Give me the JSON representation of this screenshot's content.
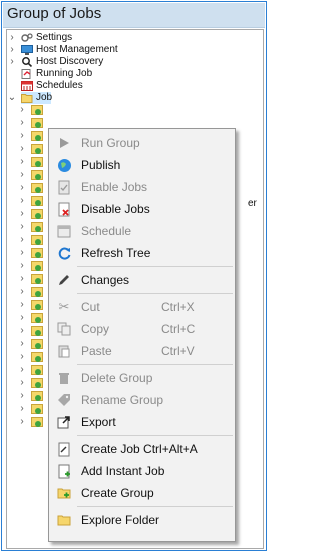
{
  "window": {
    "title": "Group of Jobs"
  },
  "tree": {
    "items": [
      {
        "label": "Settings",
        "icon": "gears-icon"
      },
      {
        "label": "Host Management",
        "icon": "monitor-icon"
      },
      {
        "label": "Host Discovery",
        "icon": "search-icon"
      },
      {
        "label": "Running Job",
        "icon": "running-job-icon"
      },
      {
        "label": "Schedules",
        "icon": "calendar-icon"
      },
      {
        "label": "Job",
        "icon": "folder-open-icon"
      }
    ],
    "side_fragment": "er"
  },
  "menu": {
    "items": [
      {
        "label": "Run Group",
        "icon": "play-icon",
        "enabled": false
      },
      {
        "label": "Publish",
        "icon": "globe-icon",
        "enabled": true
      },
      {
        "label": "Enable Jobs",
        "icon": "enable-doc-icon",
        "enabled": false
      },
      {
        "label": "Disable Jobs",
        "icon": "disable-doc-icon",
        "enabled": true
      },
      {
        "label": "Schedule",
        "icon": "calendar-icon",
        "enabled": false
      },
      {
        "label": "Refresh Tree",
        "icon": "refresh-icon",
        "enabled": true
      },
      {
        "label": "Changes",
        "icon": "pencil-icon",
        "enabled": true
      },
      {
        "label": "Cut",
        "shortcut": "Ctrl+X",
        "icon": "scissors-icon",
        "enabled": false
      },
      {
        "label": "Copy",
        "shortcut": "Ctrl+C",
        "icon": "copy-icon",
        "enabled": false
      },
      {
        "label": "Paste",
        "shortcut": "Ctrl+V",
        "icon": "paste-icon",
        "enabled": false
      },
      {
        "label": "Delete Group",
        "icon": "trash-icon",
        "enabled": false
      },
      {
        "label": "Rename Group",
        "icon": "tag-icon",
        "enabled": false
      },
      {
        "label": "Export",
        "icon": "export-icon",
        "enabled": true
      },
      {
        "label": "Create Job Ctrl+Alt+A",
        "icon": "create-job-icon",
        "enabled": true
      },
      {
        "label": "Add Instant Job",
        "icon": "add-instant-job-icon",
        "enabled": true
      },
      {
        "label": "Create Group",
        "icon": "create-group-icon",
        "enabled": true
      },
      {
        "label": "Explore Folder",
        "icon": "folder-icon",
        "enabled": true
      }
    ]
  },
  "colors": {
    "accent": "#2a7fd4",
    "titlebar_bg": "#cfe0ef",
    "selection": "#cce8ff",
    "menu_bg": "#f2f2f2",
    "disabled_text": "#8a8a8a"
  }
}
